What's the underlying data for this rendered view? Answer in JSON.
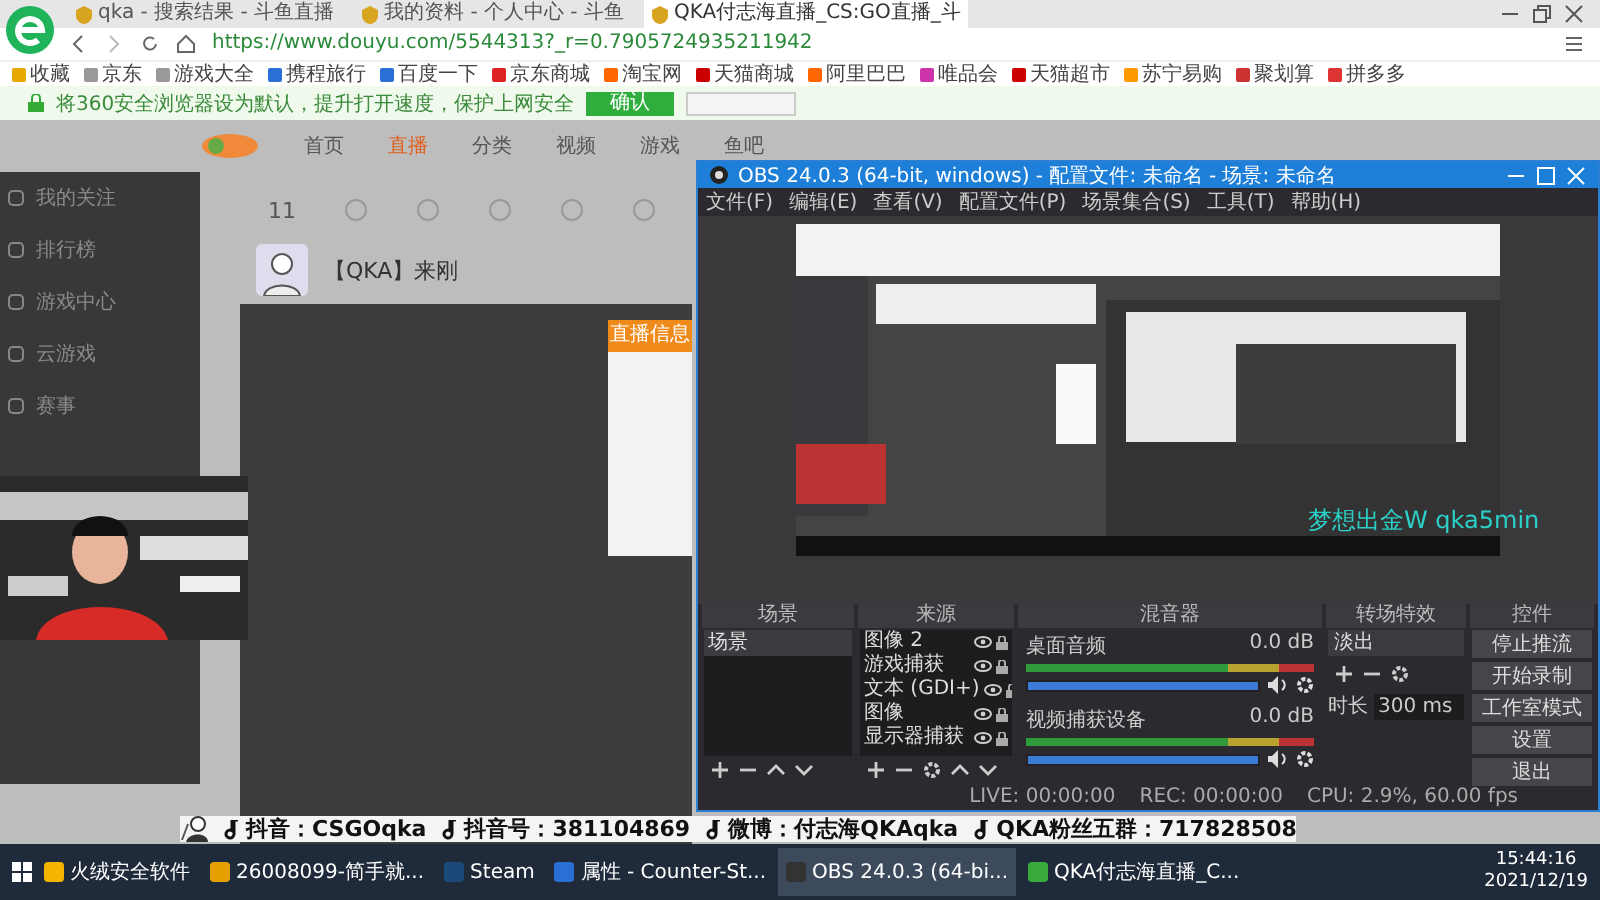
{
  "browser": {
    "tabs": [
      {
        "label": "qka - 搜索结果 - 斗鱼直播",
        "selected": false
      },
      {
        "label": "我的资料 - 个人中心 - 斗鱼",
        "selected": false
      },
      {
        "label": "QKA付志海直播_CS:GO直播_斗",
        "selected": true
      }
    ],
    "url": "https://www.douyu.com/5544313?_r=0.7905724935211942",
    "bookmarks": [
      "收藏",
      "京东",
      "游戏大全",
      "携程旅行",
      "百度一下",
      "京东商城",
      "淘宝网",
      "天猫商城",
      "阿里巴巴",
      "唯品会",
      "天猫超市",
      "苏宁易购",
      "聚划算",
      "拼多多"
    ],
    "notice": {
      "text": "将360安全浏览器设为默认，提升打开速度，保护上网安全",
      "confirm": "确认"
    }
  },
  "site": {
    "nav": [
      {
        "label": "首页",
        "selected": false
      },
      {
        "label": "直播",
        "selected": true
      },
      {
        "label": "分类",
        "selected": false
      },
      {
        "label": "视频",
        "selected": false
      },
      {
        "label": "游戏",
        "selected": false
      },
      {
        "label": "鱼吧",
        "selected": false
      }
    ],
    "sidebar": [
      "我的关注",
      "排行榜",
      "游戏中心",
      "云游戏",
      "赛事"
    ],
    "count": "11",
    "streamer": "【QKA】来刚",
    "modal_title": "直播信息"
  },
  "obs": {
    "title": "OBS 24.0.3 (64-bit, windows) - 配置文件: 未命名 - 场景: 未命名",
    "menu": [
      "文件(F)",
      "编辑(E)",
      "查看(V)",
      "配置文件(P)",
      "场景集合(S)",
      "工具(T)",
      "帮助(H)"
    ],
    "docks": [
      "场景",
      "来源",
      "混音器",
      "转场特效",
      "控件"
    ],
    "scenes": [
      {
        "label": "场景",
        "selected": true
      }
    ],
    "sources": [
      "图像 2",
      "游戏捕获",
      "文本 (GDI+)",
      "图像",
      "显示器捕获"
    ],
    "mixer": [
      {
        "name": "桌面音频",
        "reading": "0.0 dB",
        "level": 1
      },
      {
        "name": "视频捕获设备",
        "reading": "0.0 dB",
        "level": 1
      }
    ],
    "transition": {
      "type": "淡出",
      "duration_label": "时长",
      "duration": "300 ms"
    },
    "controls": [
      "停止推流",
      "开始录制",
      "工作室模式",
      "设置",
      "退出"
    ],
    "status": [
      "LIVE: 00:00:00",
      "REC: 00:00:00",
      "CPU: 2.9%, 60.00 fps"
    ],
    "overlay_text": "梦想出金W  qka5min"
  },
  "stream_overlay": [
    "抖音：CSGOqka",
    "抖音号：381104869",
    "微博：付志海QKAqka",
    "QKA粉丝五群：717828508"
  ],
  "taskbar": {
    "items": [
      {
        "label": "火绒安全软件",
        "selected": false
      },
      {
        "label": "26008099-简手就...",
        "selected": false
      },
      {
        "label": "Steam",
        "selected": false
      },
      {
        "label": "属性 - Counter-St...",
        "selected": false
      },
      {
        "label": "OBS 24.0.3 (64-bi...",
        "selected": true
      },
      {
        "label": "QKA付志海直播_C...",
        "selected": false
      }
    ],
    "time": "15:44:16",
    "date": "2021/12/19"
  }
}
